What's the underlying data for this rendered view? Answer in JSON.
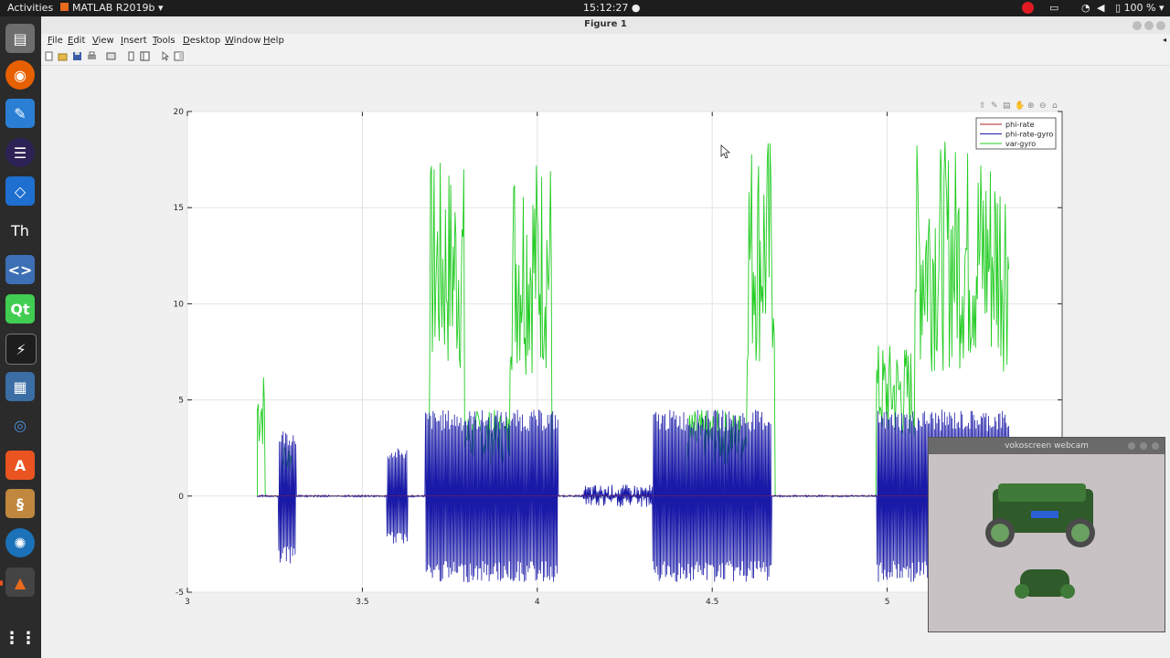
{
  "topbar": {
    "activities": "Activities",
    "app_name": "MATLAB R2019b",
    "clock": "15:12:27",
    "battery": "100 %"
  },
  "window": {
    "title": "Figure 1"
  },
  "menu": {
    "items": [
      "File",
      "Edit",
      "View",
      "Insert",
      "Tools",
      "Desktop",
      "Window",
      "Help"
    ]
  },
  "dock": {
    "icons": [
      "files-icon",
      "firefox-icon",
      "text-editor-icon",
      "eclipse-icon",
      "vscode-icon",
      "thonny-icon",
      "code-editor-icon",
      "qt-creator-icon",
      "system-monitor-icon",
      "network-icon",
      "blender-icon",
      "software-center-icon",
      "scroll-icon",
      "aperture-icon",
      "matlab-icon",
      "app-grid-icon"
    ]
  },
  "webcam": {
    "title": "vokoscreen webcam"
  },
  "chart_data": {
    "type": "line",
    "xlim": [
      3,
      5.5
    ],
    "ylim": [
      -5,
      20
    ],
    "x_ticks": [
      "3",
      "3.5",
      "4",
      "4.5",
      "5"
    ],
    "y_ticks": [
      "20",
      "15",
      "10",
      "5",
      "0",
      "-5"
    ],
    "grid": true,
    "legend_position": "top-right",
    "series": [
      {
        "name": "phi-rate",
        "color": "#b22222",
        "values": []
      },
      {
        "name": "phi-rate-gyro",
        "color": "#1a1aa8",
        "bursts": [
          {
            "x0": 3.26,
            "x1": 3.31,
            "amp": 3.5
          },
          {
            "x0": 3.57,
            "x1": 3.63,
            "amp": 2.5
          },
          {
            "x0": 3.68,
            "x1": 3.92,
            "amp": 4.5
          },
          {
            "x0": 3.92,
            "x1": 4.06,
            "amp": 4.5
          },
          {
            "x0": 4.13,
            "x1": 4.33,
            "amp": 0.6
          },
          {
            "x0": 4.33,
            "x1": 4.67,
            "amp": 4.5
          },
          {
            "x0": 4.97,
            "x1": 5.35,
            "amp": 4.5
          }
        ]
      },
      {
        "name": "var-gyro",
        "color": "#22cc22",
        "bursts": [
          {
            "x0": 3.2,
            "x1": 3.22,
            "amp": 6.7
          },
          {
            "x0": 3.27,
            "x1": 3.3,
            "amp": 3
          },
          {
            "x0": 3.69,
            "x1": 3.79,
            "amp": 17.5
          },
          {
            "x0": 3.79,
            "x1": 3.92,
            "amp": 4.5
          },
          {
            "x0": 3.92,
            "x1": 4.04,
            "amp": 18
          },
          {
            "x0": 4.43,
            "x1": 4.6,
            "amp": 4.5
          },
          {
            "x0": 4.6,
            "x1": 4.68,
            "amp": 19
          },
          {
            "x0": 4.97,
            "x1": 5.08,
            "amp": 8
          },
          {
            "x0": 5.08,
            "x1": 5.35,
            "amp": 18.5
          }
        ]
      }
    ]
  }
}
